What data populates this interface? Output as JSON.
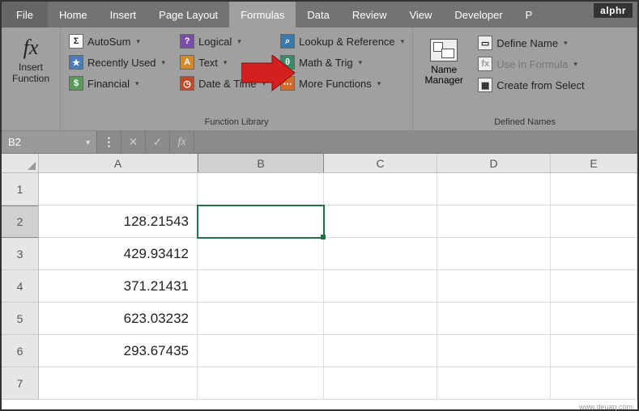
{
  "watermark": "alphr",
  "tabs": {
    "file": "File",
    "home": "Home",
    "insert": "Insert",
    "page_layout": "Page Layout",
    "formulas": "Formulas",
    "data": "Data",
    "review": "Review",
    "view": "View",
    "developer": "Developer",
    "p": "P"
  },
  "ribbon": {
    "insert_function": {
      "fx": "fx",
      "line1": "Insert",
      "line2": "Function"
    },
    "lib": {
      "autosum": "AutoSum",
      "recently": "Recently Used",
      "financial": "Financial",
      "logical": "Logical",
      "text": "Text",
      "datetime": "Date & Time",
      "lookup": "Lookup & Reference",
      "mathtrig": "Math & Trig",
      "more": "More Functions",
      "group_label": "Function Library"
    },
    "names": {
      "manager_line1": "Name",
      "manager_line2": "Manager",
      "define": "Define Name",
      "use": "Use in Formula",
      "create": "Create from Select",
      "group_label": "Defined Names"
    }
  },
  "formula_bar": {
    "name_box": "B2",
    "fx": "fx",
    "value": ""
  },
  "columns": [
    "A",
    "B",
    "C",
    "D",
    "E"
  ],
  "rows": [
    {
      "n": "1",
      "A": ""
    },
    {
      "n": "2",
      "A": "128.21543"
    },
    {
      "n": "3",
      "A": "429.93412"
    },
    {
      "n": "4",
      "A": "371.21431"
    },
    {
      "n": "5",
      "A": "623.03232"
    },
    {
      "n": "6",
      "A": "293.67435"
    },
    {
      "n": "7",
      "A": ""
    }
  ],
  "credit": "www.deuaq.com"
}
